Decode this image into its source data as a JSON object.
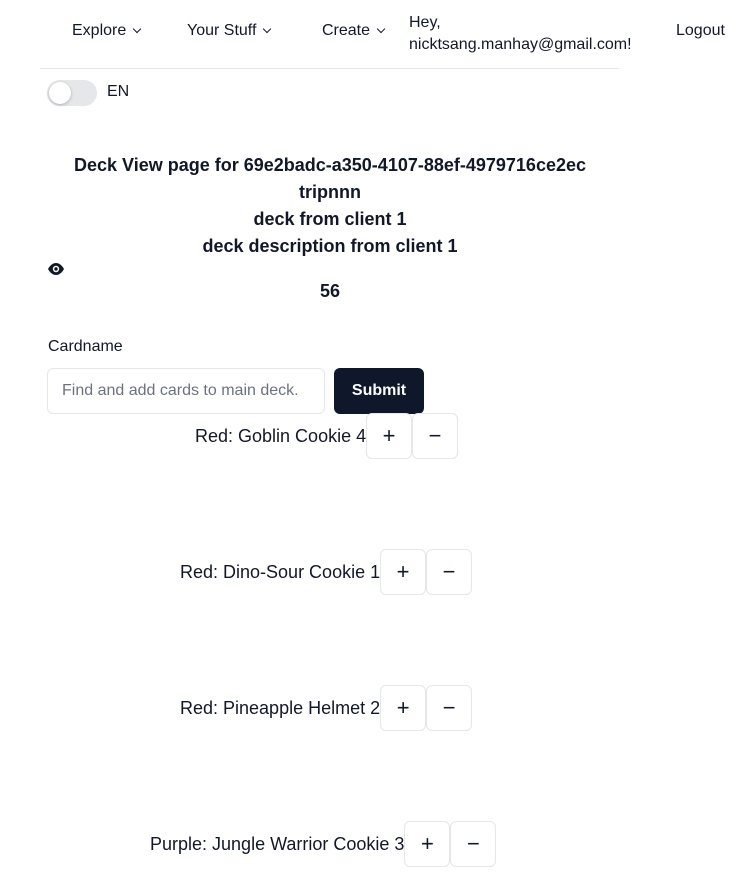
{
  "nav": {
    "items": [
      {
        "label": "Explore"
      },
      {
        "label": "Your Stuff"
      },
      {
        "label": "Create"
      }
    ],
    "greeting_line1": "Hey,",
    "greeting_line2": "nicktsang.manhay@gmail.com!",
    "logout_label": "Logout"
  },
  "language_toggle": {
    "label": "EN",
    "enabled": false
  },
  "deck": {
    "page_title": "Deck View page for 69e2badc-a350-4107-88ef-4979716ce2ec",
    "owner": "tripnnn",
    "name": "deck from client 1",
    "description": "deck description from client 1",
    "view_count": "56"
  },
  "search": {
    "label": "Cardname",
    "placeholder": "Find and add cards to main deck.",
    "submit_label": "Submit"
  },
  "cards": [
    {
      "label": "Red: Goblin Cookie 4"
    },
    {
      "label": "Red: Dino-Sour Cookie 1"
    },
    {
      "label": "Red: Pineapple Helmet 2"
    },
    {
      "label": "Purple: Jungle Warrior Cookie 3"
    }
  ],
  "card_controls": {
    "increment_symbol": "+",
    "decrement_symbol": "−"
  },
  "icons": {
    "view": "eye-icon",
    "dropdown": "chevron-down-icon"
  }
}
